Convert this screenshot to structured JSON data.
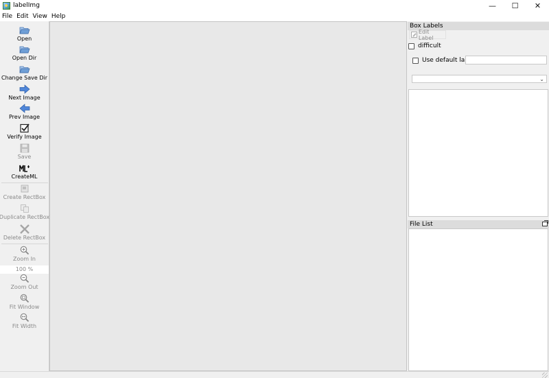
{
  "window": {
    "title": "labelImg",
    "controls": {
      "minimize": "—",
      "maximize": "☐",
      "close": "✕"
    }
  },
  "menu": [
    "File",
    "Edit",
    "View",
    "Help"
  ],
  "toolbar": {
    "open": "Open",
    "open_dir": "Open Dir",
    "change_save_dir": "Change Save Dir",
    "next_image": "Next Image",
    "prev_image": "Prev Image",
    "verify_image": "Verify Image",
    "save": "Save",
    "create_ml": "CreateML",
    "create_rectbox": "Create RectBox",
    "duplicate_rectbox": "Duplicate RectBox",
    "delete_rectbox": "Delete RectBox",
    "zoom_in": "Zoom In",
    "zoom_value": "100 %",
    "zoom_out": "Zoom Out",
    "fit_window": "Fit Window",
    "fit_width": "Fit Width"
  },
  "box_labels": {
    "title": "Box Labels",
    "edit_label": "Edit Label",
    "difficult": "difficult",
    "use_default_label": "Use default label",
    "default_label_value": "",
    "combo_value": ""
  },
  "file_list": {
    "title": "File List"
  },
  "colors": {
    "folder": "#6f9fd6",
    "arrow": "#4f86d9",
    "canvas": "#e8e8e8",
    "dock_title": "#dcdcdc"
  }
}
